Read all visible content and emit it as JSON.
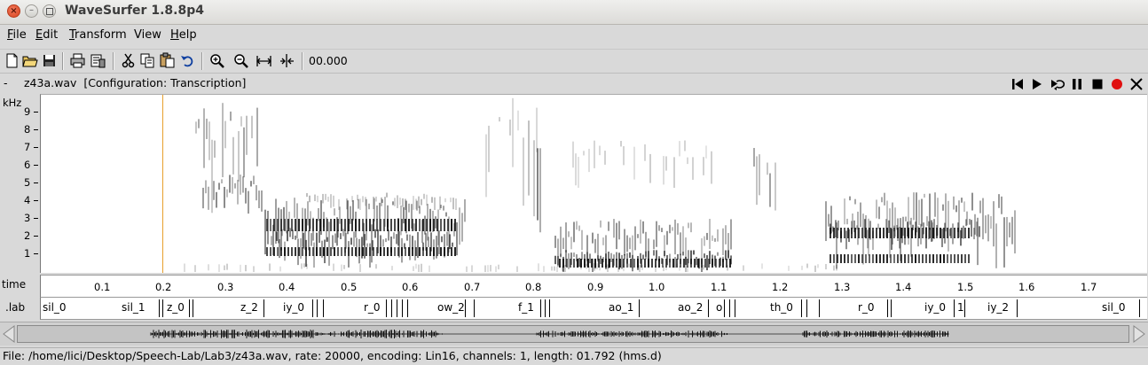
{
  "window": {
    "title": "WaveSurfer 1.8.8p4",
    "min_glyph": "–"
  },
  "menu": [
    {
      "pre": "",
      "u": "F",
      "post": "ile"
    },
    {
      "pre": "",
      "u": "E",
      "post": "dit"
    },
    {
      "pre": "",
      "u": "T",
      "post": "ransform"
    },
    {
      "pre": "",
      "u": "",
      "post": "View"
    },
    {
      "pre": "",
      "u": "H",
      "post": "elp"
    }
  ],
  "toolbar": {
    "icons": [
      "new-file-icon",
      "open-folder-icon",
      "save-icon",
      "print-icon",
      "print-setup-icon",
      "cut-icon",
      "copy-icon",
      "paste-icon",
      "undo-icon",
      "zoom-in-icon",
      "zoom-out-icon",
      "zoom-fit-icon",
      "zoom-selection-icon"
    ],
    "time_value": "00.000"
  },
  "pane": {
    "dash": "-",
    "file_label": "z43a.wav  [Configuration: Transcription]",
    "controls": [
      "skip-start-icon",
      "play-icon",
      "play-loop-icon",
      "pause-icon",
      "stop-icon",
      "record-icon",
      "close-pane-icon"
    ],
    "record_color": "#e01010"
  },
  "spectrogram": {
    "y_unit": "kHz",
    "y_ticks": [
      "9",
      "8",
      "7",
      "6",
      "5",
      "4",
      "3",
      "2",
      "1"
    ],
    "cursor_color": "#e8a02e"
  },
  "time_axis": {
    "label": "time",
    "ticks": [
      "0.1",
      "0.2",
      "0.3",
      "0.4",
      "0.5",
      "0.6",
      "0.7",
      "0.8",
      "0.9",
      "1.0",
      "1.1",
      "1.2",
      "1.3",
      "1.4",
      "1.5",
      "1.6",
      "1.7"
    ]
  },
  "transcription": {
    "label": ".lab",
    "labels": [
      "sil_0",
      "sil_1",
      "z_0",
      "z_2",
      "iy_0",
      "r_0",
      "ow_2",
      "f_1",
      "ao_1",
      "ao_2",
      "o",
      "th_0",
      "r_0",
      "iy_0",
      "1",
      "iy_2",
      "sil_0"
    ]
  },
  "status": {
    "text": "File: /home/lici/Desktop/Speech-Lab/Lab3/z43a.wav, rate: 20000, encoding: Lin16, channels: 1, length: 01.792 (hms.d)"
  }
}
